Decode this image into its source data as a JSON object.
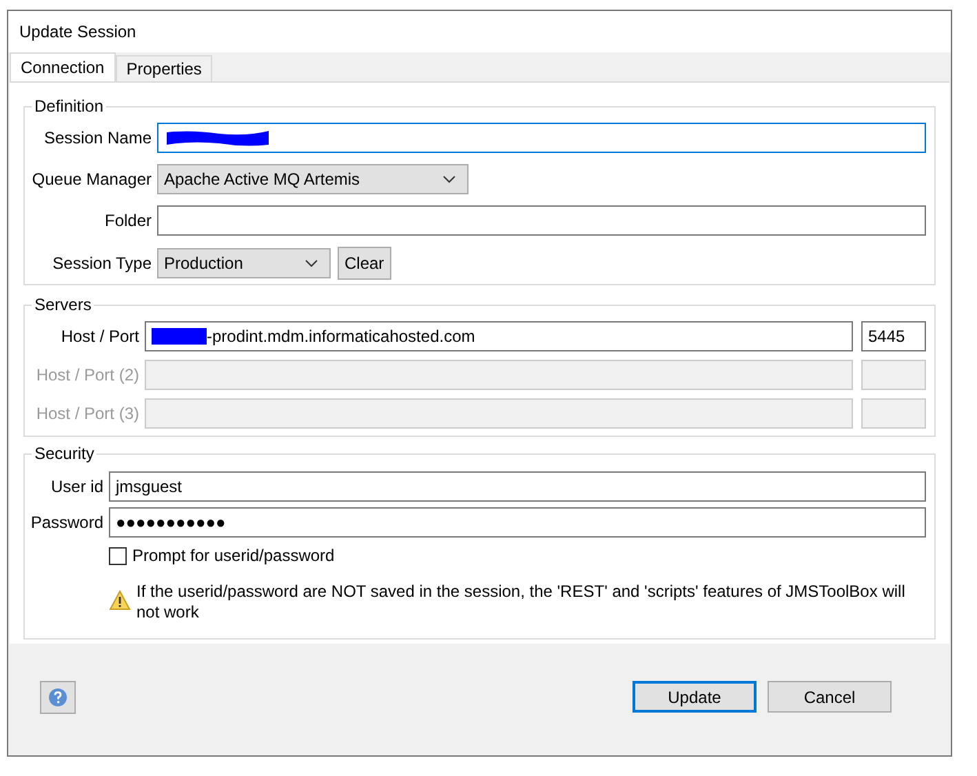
{
  "window": {
    "title": "Update Session"
  },
  "tabs": [
    {
      "label": "Connection",
      "selected": true
    },
    {
      "label": "Properties",
      "selected": false
    }
  ],
  "definition": {
    "title": "Definition",
    "session_name": {
      "label": "Session Name",
      "redacted": true,
      "focused": true
    },
    "queue_manager": {
      "label": "Queue Manager",
      "value": "Apache Active MQ Artemis"
    },
    "folder": {
      "label": "Folder"
    },
    "session_type": {
      "label": "Session Type",
      "value": "Production"
    },
    "clear_button": "Clear"
  },
  "servers": {
    "title": "Servers",
    "rows": [
      {
        "label": "Host / Port",
        "host": "-prodint.mdm.informaticahosted.com",
        "port": "5445",
        "redacted": true,
        "disabled": false
      },
      {
        "label": "Host / Port (2)",
        "redacted": false,
        "disabled": true
      },
      {
        "label": "Host / Port (3)",
        "redacted": false,
        "disabled": true
      }
    ]
  },
  "security": {
    "title": "Security",
    "user_id": {
      "label": "User id",
      "value": "jmsguest"
    },
    "password": {
      "label": "Password",
      "value": "●●●●●●●●●●●"
    },
    "prompt": {
      "label": "Prompt for userid/password",
      "checked": false
    },
    "warning": "If the userid/password are NOT saved in the session, the 'REST' and 'scripts' features of JMSToolBox will not work"
  },
  "buttons": [
    {
      "label": "Update",
      "default": true
    },
    {
      "label": "Cancel",
      "default": false
    }
  ]
}
